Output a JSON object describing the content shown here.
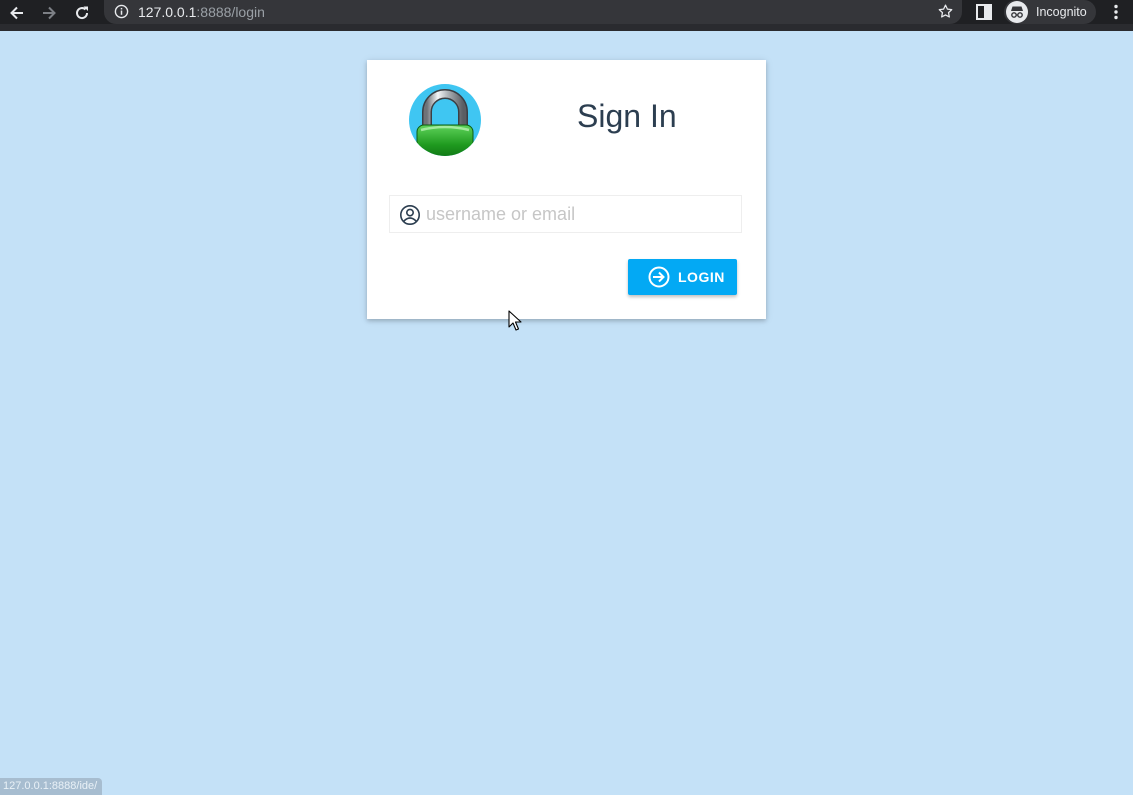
{
  "browser": {
    "url_host": "127.0.0.1",
    "url_rest": ":8888/login",
    "profile_label": "Incognito",
    "status_url": "127.0.0.1:8888/ide/",
    "icons": [
      "back-arrow-icon",
      "forward-arrow-icon",
      "reload-icon",
      "info-icon",
      "star-icon",
      "side-panel-icon",
      "incognito-icon",
      "more-vert-icon"
    ]
  },
  "login": {
    "title": "Sign In",
    "username_placeholder": "username or email",
    "username_value": "",
    "login_button_label": "LOGIN",
    "icons": [
      "padlock-logo",
      "user-circle-icon",
      "login-arrow-icon"
    ]
  },
  "colors": {
    "page_background": "#c4e1f7",
    "accent": "#03a9f4",
    "title_text": "#2c3e50"
  }
}
